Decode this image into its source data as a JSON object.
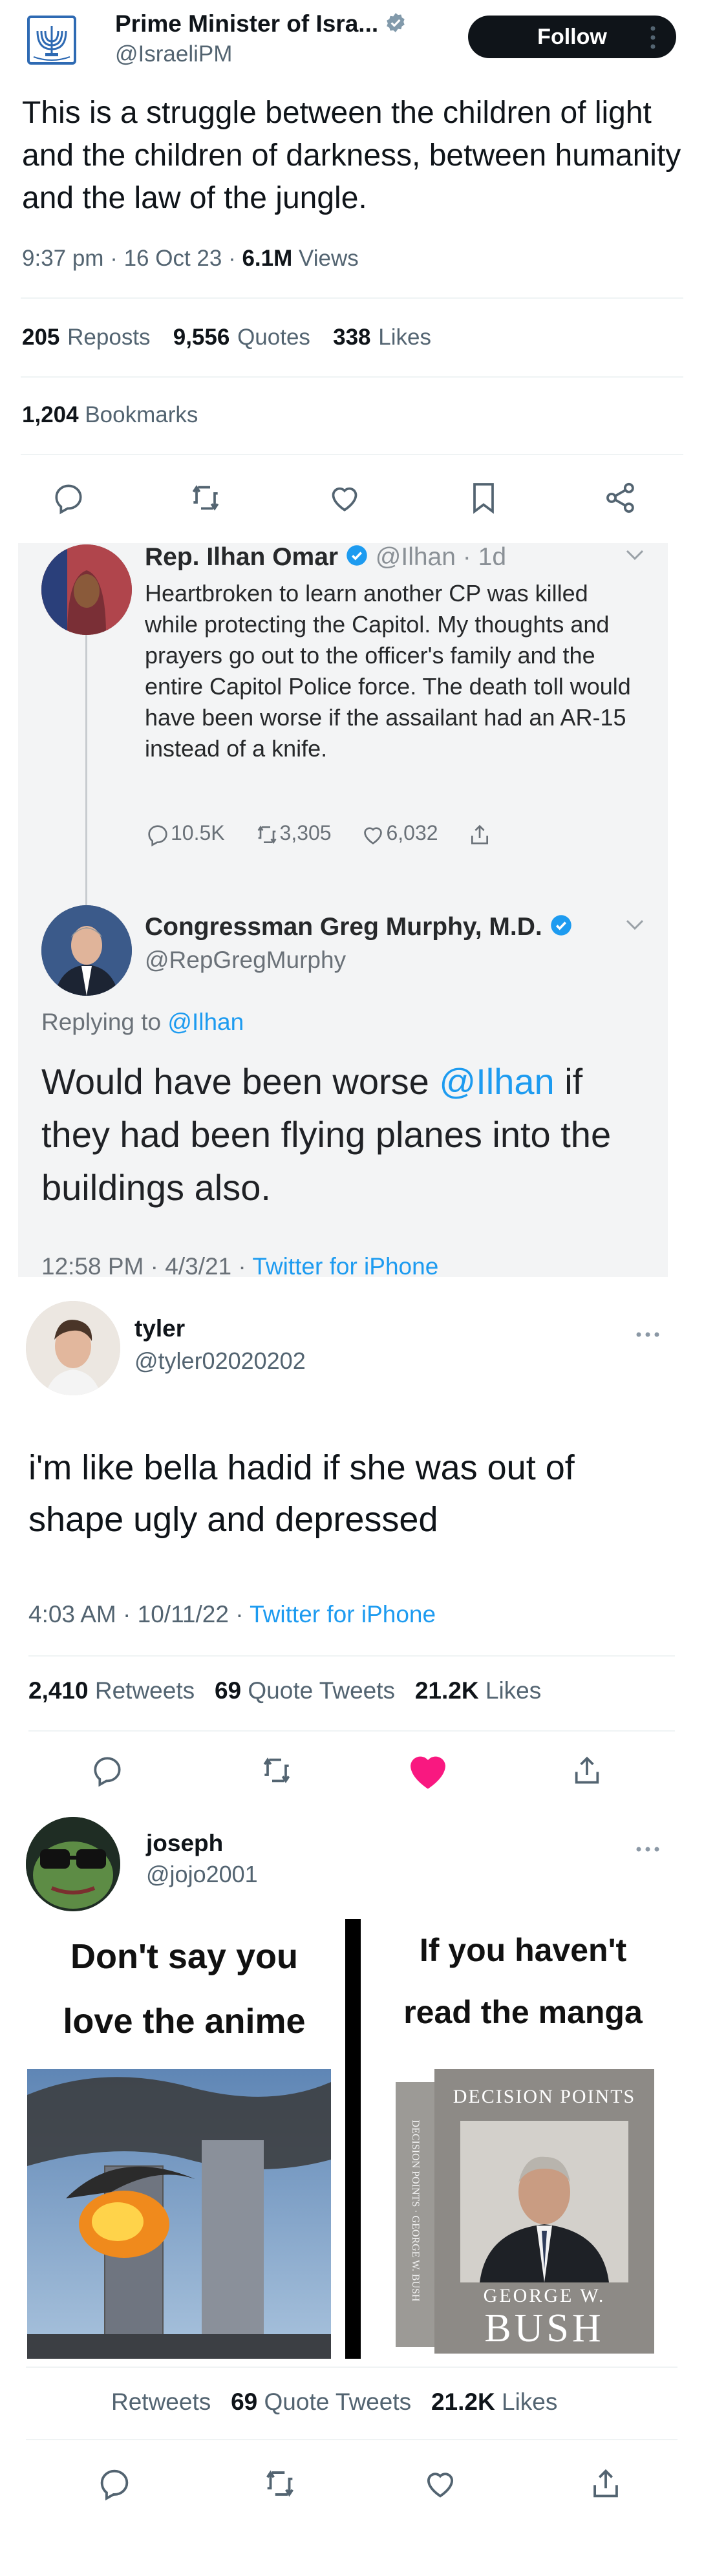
{
  "tweet1": {
    "author_name": "Prime Minister of Isra...",
    "author_handle": "@IsraeliPM",
    "follow_label": "Follow",
    "body": "This is a struggle between the children of light and the children of darkness, between humanity and the law of the jungle.",
    "time": "9:37 pm",
    "date": "16 Oct 23",
    "views_count": "6.1M",
    "views_label": "Views",
    "reposts_count": "205",
    "reposts_label": "Reposts",
    "quotes_count": "9,556",
    "quotes_label": "Quotes",
    "likes_count": "338",
    "likes_label": "Likes",
    "bookmarks_count": "1,204",
    "bookmarks_label": "Bookmarks"
  },
  "embedded": {
    "tweet_a": {
      "author_name": "Rep. Ilhan Omar",
      "author_handle": "@Ilhan",
      "age": "1d",
      "body": "Heartbroken to learn another CP was killed while protecting the Capitol. My thoughts and prayers go out to the officer's family and the entire Capitol Police force. The death toll would have been worse if the assailant had an AR-15 instead of a knife.",
      "replies": "10.5K",
      "retweets": "3,305",
      "likes": "6,032"
    },
    "tweet_b": {
      "author_name": "Congressman Greg Murphy, M.D.",
      "author_handle": "@RepGregMurphy",
      "replying_prefix": "Replying to",
      "replying_handle": "@Ilhan",
      "body_1": "Would have been worse",
      "body_mention": "@Ilhan",
      "body_2": "if they had been flying planes into the buildings also.",
      "time": "12:58 PM",
      "date": "4/3/21",
      "source": "Twitter for iPhone"
    }
  },
  "tweet2": {
    "author_name": "tyler",
    "author_handle": "@tyler02020202",
    "body": "i'm like bella hadid if she was out of shape ugly and depressed",
    "time": "4:03 AM",
    "date": "10/11/22",
    "source": "Twitter for iPhone",
    "retweets_count": "2,410",
    "retweets_label": "Retweets",
    "quotes_count": "69",
    "quotes_label": "Quote Tweets",
    "likes_count": "21.2K",
    "likes_label": "Likes"
  },
  "tweet3": {
    "author_name": "joseph",
    "author_handle": "@jojo2001",
    "meme_left_line1": "Don't say you",
    "meme_left_line2": "love the anime",
    "meme_right_line1": "If you haven't",
    "meme_right_line2": "read the manga",
    "book_title": "DECISION POINTS",
    "book_author_first": "GEORGE W.",
    "book_author_last": "BUSH",
    "book_spine": "DECISION POINTS · GEORGE W. BUSH",
    "retweets_label": "Retweets",
    "quotes_count": "69",
    "quotes_label": "Quote Tweets",
    "likes_count": "21.2K",
    "likes_label": "Likes"
  },
  "colors": {
    "accent": "#1d9bf0",
    "like_red": "#f91880",
    "text": "#0f1419",
    "muted": "#536471",
    "verified": "#829aab"
  }
}
